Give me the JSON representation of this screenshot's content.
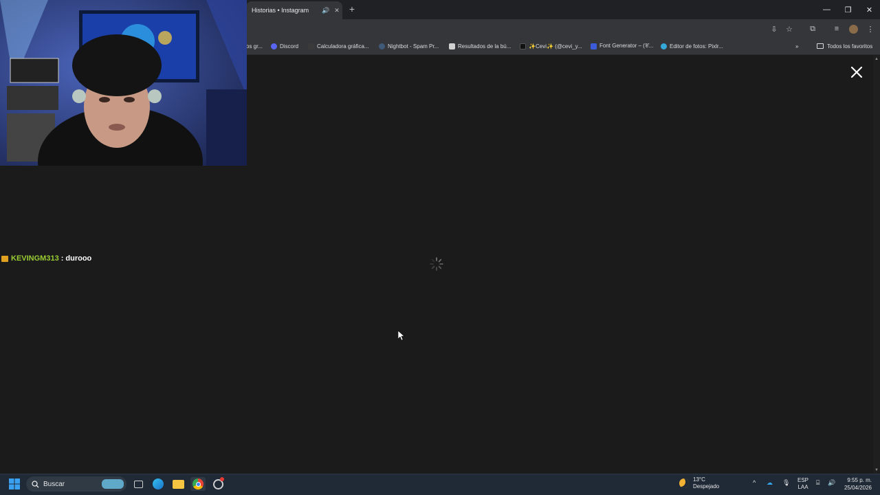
{
  "browser": {
    "tab_title": "Historias • Instagram",
    "bookmarks": [
      {
        "label": "os gr...",
        "color": "#5f6368"
      },
      {
        "label": "Discord",
        "color": "#5865f2"
      },
      {
        "label": "Calculadora gráfica...",
        "color": "#3a3a3a"
      },
      {
        "label": "Nightbot - Spam Pr...",
        "color": "#3f5a78"
      },
      {
        "label": "Resultados de la bú...",
        "color": "#d0d0d0"
      },
      {
        "label": "✨Cevi✨ (@cevi_y...",
        "color": "#111111"
      },
      {
        "label": "Font Generator – (𝒞...",
        "color": "#3b5bdb"
      },
      {
        "label": "Editor de fotos: Pixlr...",
        "color": "#35a7d8"
      }
    ],
    "all_bookmarks_label": "Todos los favoritos"
  },
  "chat": {
    "username": "KEVINGM313",
    "separator": ":",
    "message": "durooo"
  },
  "taskbar": {
    "search_label": "Buscar",
    "weather_temp": "13°C",
    "weather_desc": "Despejado",
    "lang_top": "ESP",
    "lang_bottom": "LAA",
    "time": "9:55 p. m.",
    "date": "25/04/2026"
  },
  "colors": {
    "chat_username": "#9acd32",
    "accent": "#4285f4"
  }
}
